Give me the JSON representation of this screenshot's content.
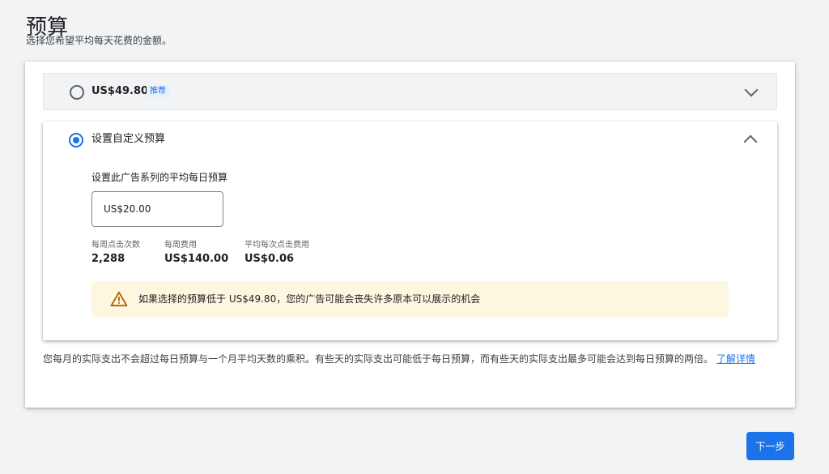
{
  "header": {
    "title": "预算",
    "subtitle": "选择您希望平均每天花费的金额。"
  },
  "recommended_option": {
    "price": "US$49.80",
    "badge": "推荐",
    "selected": false
  },
  "custom_option": {
    "label": "设置自定义预算",
    "selected": true,
    "field_label": "设置此广告系列的平均每日预算",
    "input_value": "US$20.00",
    "stats": [
      {
        "label": "每周点击次数",
        "value": "2,288"
      },
      {
        "label": "每周费用",
        "value": "US$140.00"
      },
      {
        "label": "平均每次点击费用",
        "value": "US$0.06"
      }
    ],
    "warning": "如果选择的预算低于 US$49.80，您的广告可能会丧失许多原本可以展示的机会"
  },
  "footnote": {
    "text": "您每月的实际支出不会超过每日预算与一个月平均天数的乘积。有些天的实际支出可能低于每日预算，而有些天的实际支出最多可能会达到每日预算的两倍。",
    "link": "了解详情"
  },
  "footer": {
    "next_label": "下一步"
  },
  "colors": {
    "primary": "#1a73e8",
    "warning_bg": "#fef7e0",
    "warning_icon": "#b06000"
  }
}
